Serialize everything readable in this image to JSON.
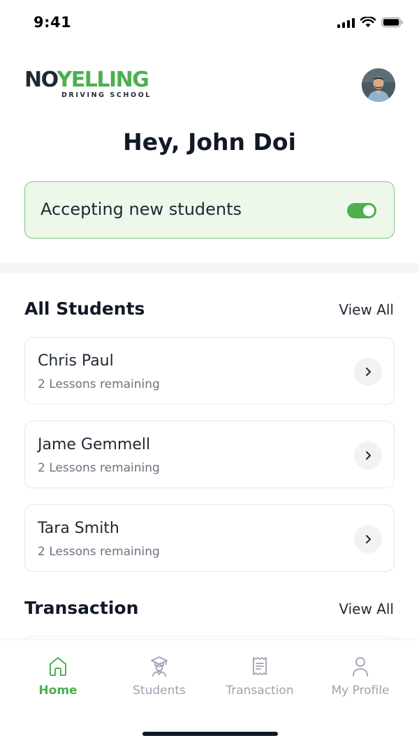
{
  "status_bar": {
    "time": "9:41"
  },
  "logo": {
    "part_no": "NO",
    "part_yelling": "YELLING",
    "subtitle": "DRIVING SCHOOL"
  },
  "header": {
    "greeting": "Hey, John Doi"
  },
  "accepting": {
    "label": "Accepting new students",
    "enabled": true
  },
  "sections": {
    "students": {
      "title": "All Students",
      "view_all": "View All"
    },
    "transaction": {
      "title": "Transaction",
      "view_all": "View All"
    }
  },
  "students": [
    {
      "name": "Chris Paul",
      "lessons": "2 Lessons remaining"
    },
    {
      "name": "Jame Gemmell",
      "lessons": "2 Lessons remaining"
    },
    {
      "name": "Tara Smith",
      "lessons": "2 Lessons remaining"
    }
  ],
  "nav": [
    {
      "label": "Home",
      "icon": "home-icon",
      "active": true
    },
    {
      "label": "Students",
      "icon": "graduate-icon",
      "active": false
    },
    {
      "label": "Transaction",
      "icon": "receipt-icon",
      "active": false
    },
    {
      "label": "My Profile",
      "icon": "profile-icon",
      "active": false
    }
  ],
  "colors": {
    "accent": "#4caf50",
    "card_bg": "#edf7ea",
    "text": "#111827",
    "muted": "#9ca3af"
  }
}
